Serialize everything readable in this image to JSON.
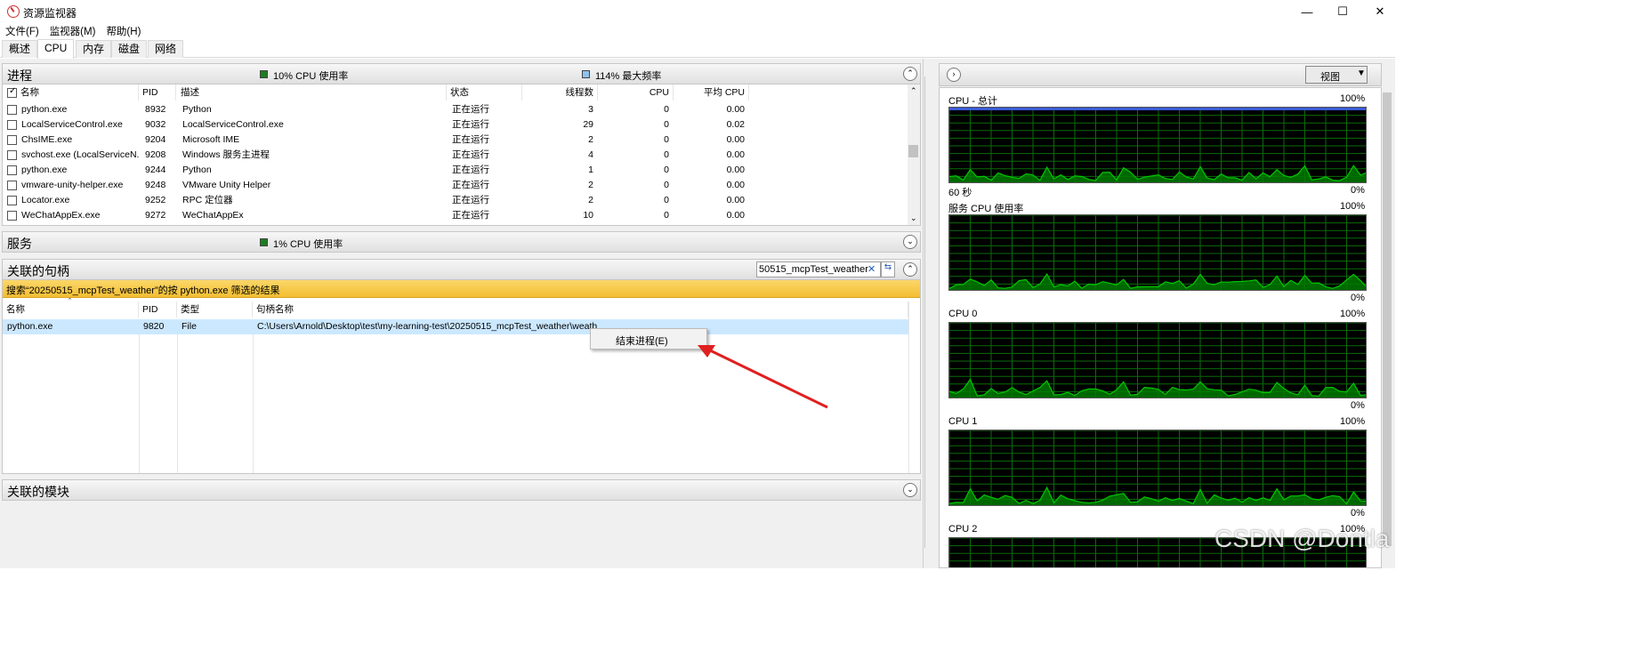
{
  "window": {
    "title": "资源监视器",
    "minimize": "—",
    "maximize": "☐",
    "close": "✕"
  },
  "menu": [
    "文件(F)",
    "监视器(M)",
    "帮助(H)"
  ],
  "tabs": [
    "概述",
    "CPU",
    "内存",
    "磁盘",
    "网络"
  ],
  "processes": {
    "title": "进程",
    "cpu_usage": "10% CPU 使用率",
    "max_freq": "114% 最大频率",
    "columns": [
      "名称",
      "PID",
      "描述",
      "状态",
      "线程数",
      "CPU",
      "平均 CPU"
    ],
    "rows": [
      [
        "python.exe",
        "8932",
        "Python",
        "正在运行",
        "3",
        "0",
        "0.00"
      ],
      [
        "LocalServiceControl.exe",
        "9032",
        "LocalServiceControl.exe",
        "正在运行",
        "29",
        "0",
        "0.02"
      ],
      [
        "ChsIME.exe",
        "9204",
        "Microsoft IME",
        "正在运行",
        "2",
        "0",
        "0.00"
      ],
      [
        "svchost.exe (LocalServiceN...",
        "9208",
        "Windows 服务主进程",
        "正在运行",
        "4",
        "0",
        "0.00"
      ],
      [
        "python.exe",
        "9244",
        "Python",
        "正在运行",
        "1",
        "0",
        "0.00"
      ],
      [
        "vmware-unity-helper.exe",
        "9248",
        "VMware Unity Helper",
        "正在运行",
        "2",
        "0",
        "0.00"
      ],
      [
        "Locator.exe",
        "9252",
        "RPC 定位器",
        "正在运行",
        "2",
        "0",
        "0.00"
      ],
      [
        "WeChatAppEx.exe",
        "9272",
        "WeChatAppEx",
        "正在运行",
        "10",
        "0",
        "0.00"
      ]
    ]
  },
  "services": {
    "title": "服务",
    "cpu_usage": "1% CPU 使用率"
  },
  "handles": {
    "title": "关联的句柄",
    "search_value": "20250515_mcpTest_weather",
    "search_shown": "50515_mcpTest_weather",
    "filter_banner": "搜索“20250515_mcpTest_weather”的按 python.exe 筛选的结果",
    "columns": [
      "名称",
      "PID",
      "类型",
      "句柄名称"
    ],
    "rows": [
      [
        "python.exe",
        "9820",
        "File",
        "C:\\Users\\Arnold\\Desktop\\test\\my-learning-test\\20250515_mcpTest_weather\\weather"
      ]
    ]
  },
  "modules": {
    "title": "关联的模块"
  },
  "context_menu": {
    "item": "结束进程(E)"
  },
  "right": {
    "view_button": "视图",
    "graphs": [
      {
        "title": "CPU - 总计",
        "max": "100%",
        "min": "0%",
        "time": "60 秒"
      },
      {
        "title": "服务 CPU 使用率",
        "max": "100%",
        "min": "0%"
      },
      {
        "title": "CPU 0",
        "max": "100%",
        "min": "0%"
      },
      {
        "title": "CPU 1",
        "max": "100%",
        "min": "0%"
      },
      {
        "title": "CPU 2",
        "max": "100%"
      }
    ]
  },
  "watermark": "CSDN @Dontla",
  "colors": {
    "graph_line": "#00c800",
    "graph_fill": "#007a00",
    "grid": "#0b6b0b",
    "banner": "#f6c943",
    "selection": "#cce8ff",
    "max_freq_bar": "#3b5bd6",
    "arrow": "#e02020"
  }
}
